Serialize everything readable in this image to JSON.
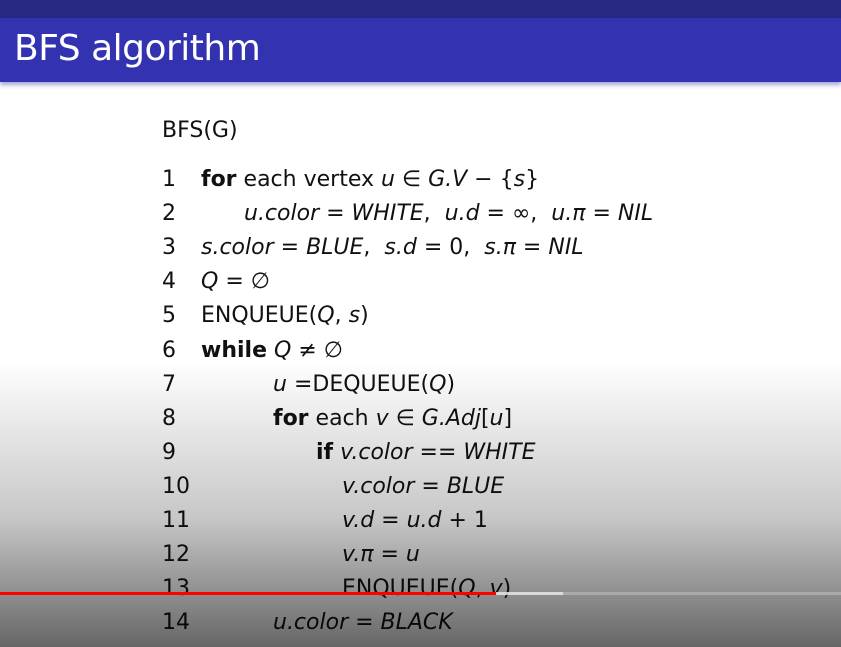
{
  "slide": {
    "title": "BFS algorithm",
    "procedure": "BFS(G)",
    "lines": [
      {
        "num": "1",
        "segments": [
          {
            "t": "for",
            "s": "b"
          },
          {
            "t": " each vertex ",
            "s": "n"
          },
          {
            "t": "u",
            "s": "i"
          },
          {
            "t": " ∈ ",
            "s": "n"
          },
          {
            "t": "G.V",
            "s": "i"
          },
          {
            "t": " − {",
            "s": "n"
          },
          {
            "t": "s",
            "s": "i"
          },
          {
            "t": "}",
            "s": "n"
          }
        ]
      },
      {
        "num": "2",
        "segments": [
          {
            "t": "u.color",
            "s": "i"
          },
          {
            "t": " = ",
            "s": "n"
          },
          {
            "t": "WHITE",
            "s": "i"
          },
          {
            "t": ",  ",
            "s": "n"
          },
          {
            "t": "u.d",
            "s": "i"
          },
          {
            "t": " = ∞,  ",
            "s": "n"
          },
          {
            "t": "u.π",
            "s": "i"
          },
          {
            "t": " = ",
            "s": "n"
          },
          {
            "t": "NIL",
            "s": "i"
          }
        ]
      },
      {
        "num": "3",
        "segments": [
          {
            "t": "s.color",
            "s": "i"
          },
          {
            "t": " = ",
            "s": "n"
          },
          {
            "t": "BLUE",
            "s": "i"
          },
          {
            "t": ",  ",
            "s": "n"
          },
          {
            "t": "s.d",
            "s": "i"
          },
          {
            "t": " = 0,  ",
            "s": "n"
          },
          {
            "t": "s.π",
            "s": "i"
          },
          {
            "t": " = ",
            "s": "n"
          },
          {
            "t": "NIL",
            "s": "i"
          }
        ]
      },
      {
        "num": "4",
        "segments": [
          {
            "t": "Q",
            "s": "i"
          },
          {
            "t": " = ∅",
            "s": "n"
          }
        ]
      },
      {
        "num": "5",
        "segments": [
          {
            "t": "ENQUEUE(",
            "s": "n"
          },
          {
            "t": "Q",
            "s": "i"
          },
          {
            "t": ", ",
            "s": "n"
          },
          {
            "t": "s",
            "s": "i"
          },
          {
            "t": ")",
            "s": "n"
          }
        ]
      },
      {
        "num": "6",
        "segments": [
          {
            "t": "while",
            "s": "b"
          },
          {
            "t": " ",
            "s": "n"
          },
          {
            "t": "Q",
            "s": "i"
          },
          {
            "t": " ≠ ∅",
            "s": "n"
          }
        ]
      },
      {
        "num": "7",
        "segments": [
          {
            "t": "u",
            "s": "i"
          },
          {
            "t": " =DEQUEUE(",
            "s": "n"
          },
          {
            "t": "Q",
            "s": "i"
          },
          {
            "t": ")",
            "s": "n"
          }
        ]
      },
      {
        "num": "8",
        "segments": [
          {
            "t": "for",
            "s": "b"
          },
          {
            "t": " each ",
            "s": "n"
          },
          {
            "t": "v",
            "s": "i"
          },
          {
            "t": " ∈ ",
            "s": "n"
          },
          {
            "t": "G.Adj",
            "s": "i"
          },
          {
            "t": "[",
            "s": "n"
          },
          {
            "t": "u",
            "s": "i"
          },
          {
            "t": "]",
            "s": "n"
          }
        ]
      },
      {
        "num": "9",
        "segments": [
          {
            "t": "if",
            "s": "b"
          },
          {
            "t": " ",
            "s": "n"
          },
          {
            "t": "v.color",
            "s": "i"
          },
          {
            "t": " == ",
            "s": "n"
          },
          {
            "t": "WHITE",
            "s": "i"
          }
        ]
      },
      {
        "num": "10",
        "segments": [
          {
            "t": "v.color",
            "s": "i"
          },
          {
            "t": " = ",
            "s": "n"
          },
          {
            "t": "BLUE",
            "s": "i"
          }
        ]
      },
      {
        "num": "11",
        "segments": [
          {
            "t": "v.d",
            "s": "i"
          },
          {
            "t": " = ",
            "s": "n"
          },
          {
            "t": "u.d",
            "s": "i"
          },
          {
            "t": " + 1",
            "s": "n"
          }
        ]
      },
      {
        "num": "12",
        "segments": [
          {
            "t": "v.π",
            "s": "i"
          },
          {
            "t": " = ",
            "s": "n"
          },
          {
            "t": "u",
            "s": "i"
          }
        ]
      },
      {
        "num": "13",
        "segments": [
          {
            "t": "ENQUEUE(",
            "s": "n"
          },
          {
            "t": "Q",
            "s": "i"
          },
          {
            "t": ", ",
            "s": "n"
          },
          {
            "t": "v",
            "s": "i"
          },
          {
            "t": ")",
            "s": "n"
          }
        ]
      },
      {
        "num": "14",
        "segments": [
          {
            "t": "u.color",
            "s": "i"
          },
          {
            "t": " = ",
            "s": "n"
          },
          {
            "t": "BLACK",
            "s": "i"
          }
        ]
      }
    ]
  },
  "player": {
    "progress_percent": 59,
    "buffered_percent": 67,
    "colors": {
      "played": "#ff0000",
      "title_bar": "#3333b2",
      "header_strip": "#272884"
    }
  }
}
